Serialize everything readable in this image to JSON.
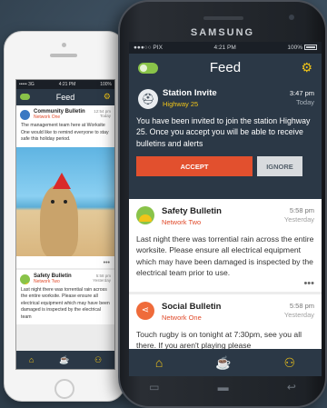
{
  "back_phone": {
    "status": {
      "left": "••••• 3G",
      "time": "4:21 PM",
      "battery": "100%"
    },
    "header": {
      "title": "Feed"
    },
    "card1": {
      "title": "Community Bulletin",
      "network": "Network One",
      "time": "12:54 pm",
      "day": "Today",
      "body": "The management team here at Worksite One would like to remind everyone to stay safe this holiday period."
    },
    "card2": {
      "title": "Safety Bulletin",
      "network": "Network Two",
      "time": "5:58 pm",
      "day": "Yesterday",
      "body": "Last night there was torrential rain across the entire worksite. Please ensure all electrical equipment which may have been damaged is inspected by the electrical team"
    },
    "dots": "•••"
  },
  "front_phone": {
    "brand": "SAMSUNG",
    "status": {
      "left": "●●●○○ PIX",
      "time": "4:21 PM",
      "battery": "100%"
    },
    "header": {
      "title": "Feed"
    },
    "invite": {
      "title": "Station Invite",
      "subtitle": "Highway 25",
      "time": "3:47 pm",
      "day": "Today",
      "body": "You have been invited to join the station Highway 25. Once you accept you will be able to receive bulletins and alerts",
      "accept_label": "ACCEPT",
      "ignore_label": "IGNORE"
    },
    "safety": {
      "title": "Safety Bulletin",
      "network": "Network Two",
      "time": "5:58 pm",
      "day": "Yesterday",
      "body": "Last night there was torrential rain across the entire worksite. Please ensure all electrical equipment which may have been damaged is inspected by the electrical team prior to use.",
      "dots": "•••"
    },
    "social": {
      "title": "Social Bulletin",
      "network": "Network One",
      "time": "5:58 pm",
      "day": "Yesterday",
      "body": "Touch rugby is on tonight at 7:30pm, see you all there. If you aren't playing please"
    },
    "nav": {
      "home_icon": "⌂",
      "drink_icon": "☕",
      "user_icon": "⚇"
    }
  },
  "colors": {
    "header": "#2b3846",
    "accent": "#f0c419",
    "accept": "#e2502e",
    "toggle": "#89c349"
  }
}
